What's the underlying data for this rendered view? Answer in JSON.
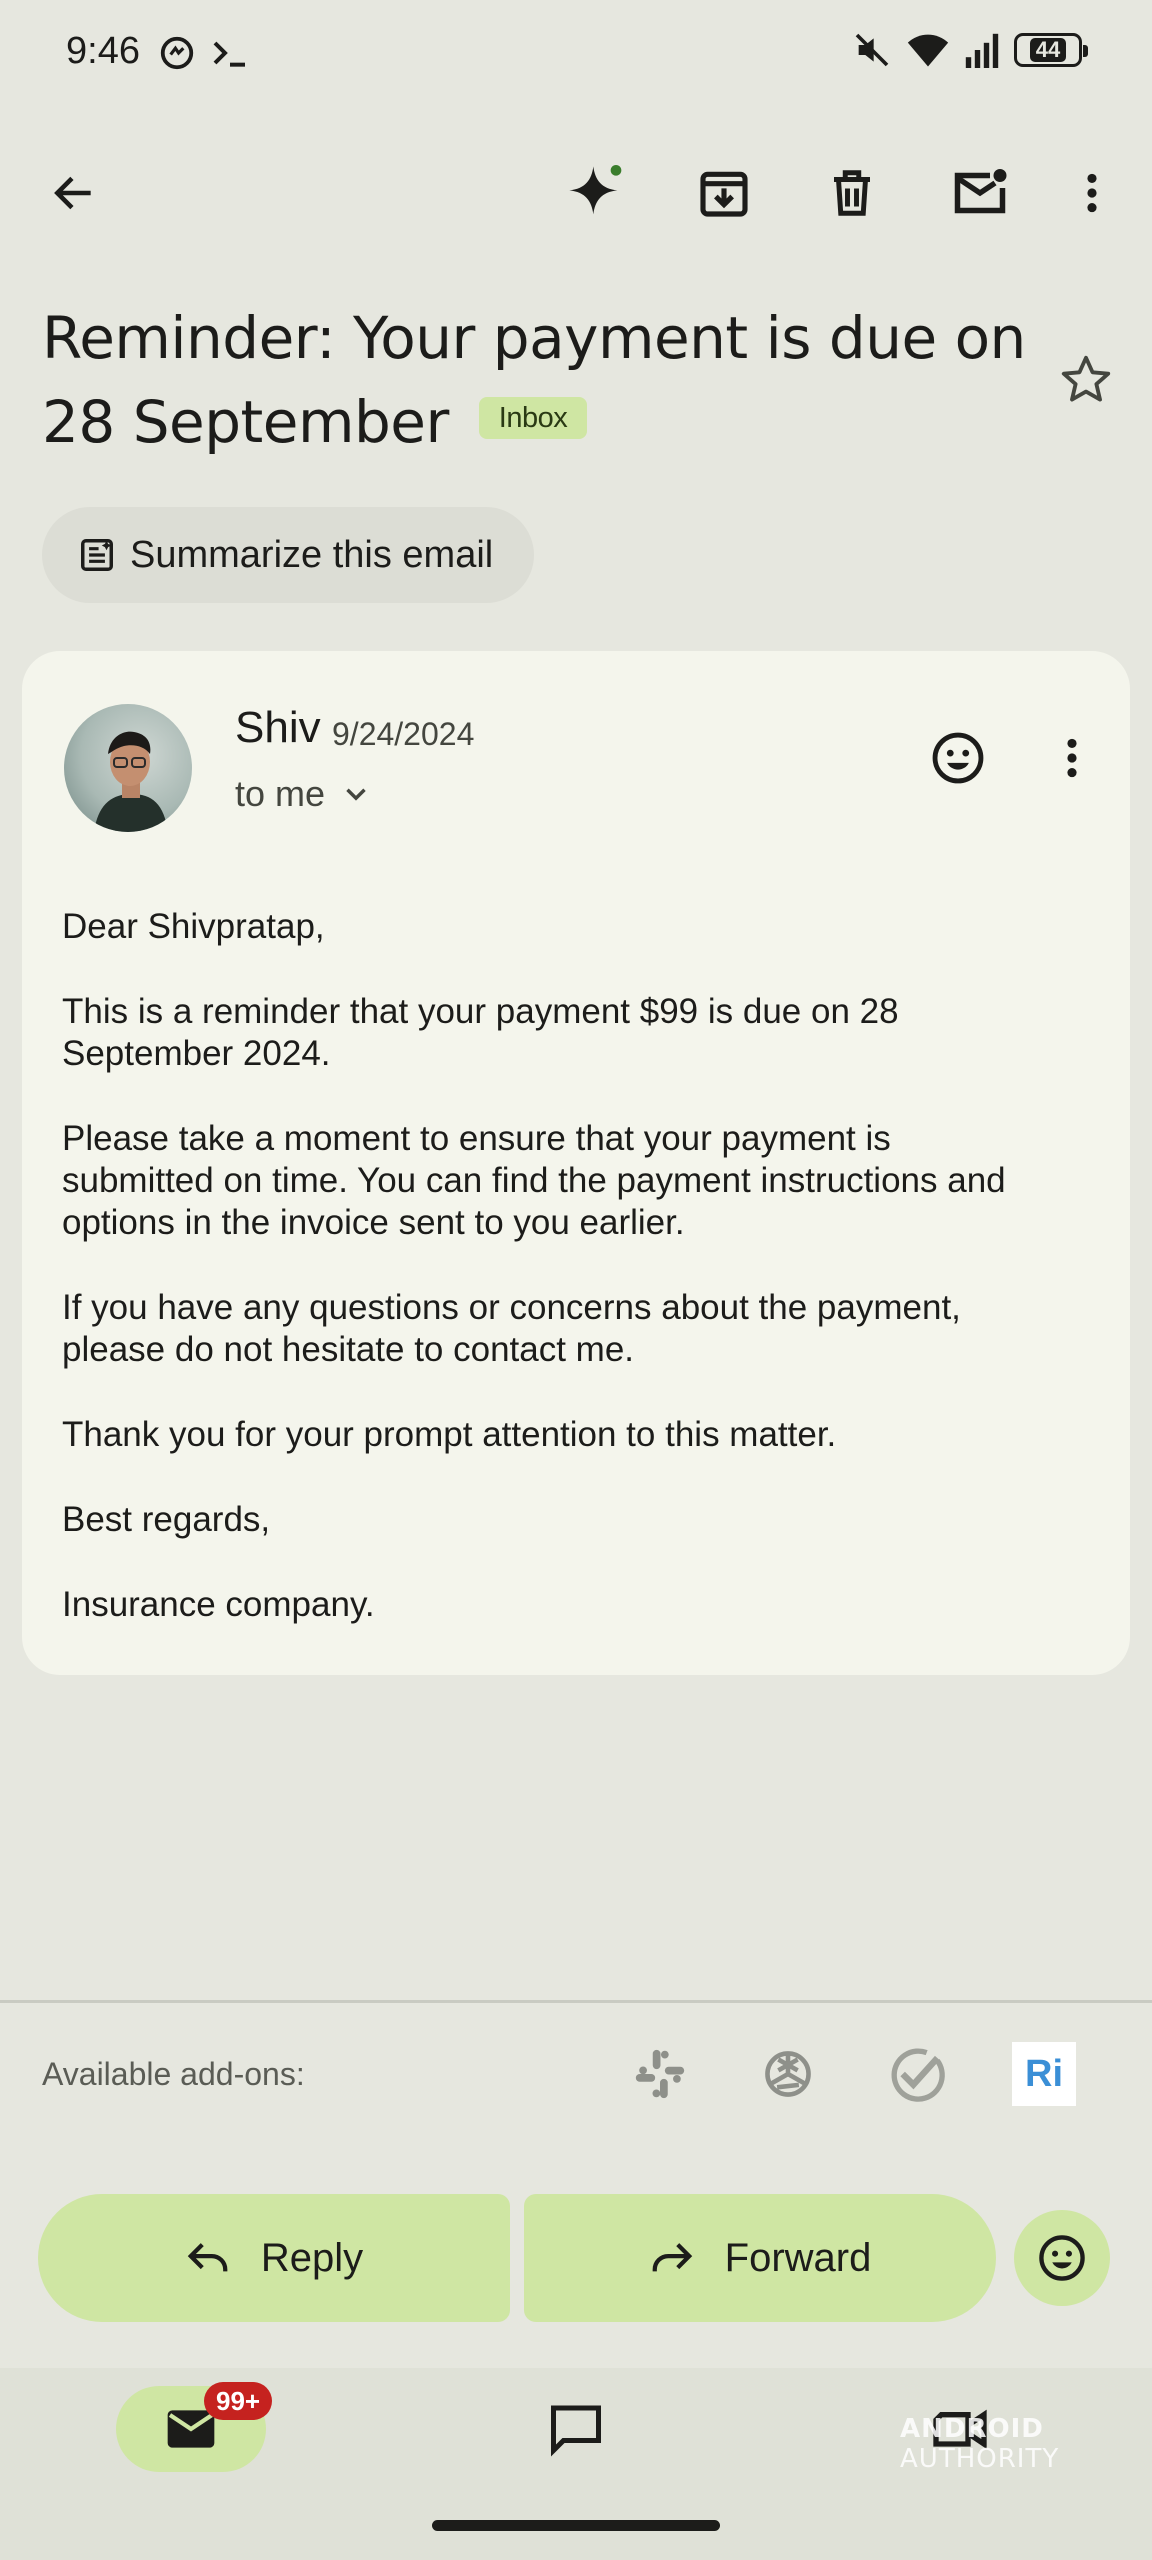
{
  "status_bar": {
    "time": "9:46",
    "battery": "44",
    "icons": [
      "data-saver-icon",
      "terminal-icon",
      "mute-icon",
      "wifi-icon",
      "signal-icon",
      "battery-icon"
    ]
  },
  "toolbar": {
    "icons": [
      "back-arrow-icon",
      "gemini-sparkle-icon",
      "archive-icon",
      "delete-icon",
      "mark-unread-icon",
      "more-vert-icon"
    ]
  },
  "email": {
    "subject": "Reminder: Your payment is due on 28 September",
    "label": "Inbox",
    "summarize_label": "Summarize this email",
    "sender": "Shiv",
    "date": "9/24/2024",
    "recipient": "to me",
    "body": [
      "Dear Shivpratap,",
      "This is a reminder that your payment $99 is due on 28\nSeptember 2024.",
      "Please take a moment to ensure that your payment is\nsubmitted on time. You can find the payment instructions and\noptions in the invoice sent to you earlier.",
      "If you have any questions or concerns about the payment,\nplease do not hesitate to contact me.",
      "Thank you for your prompt attention to this matter.",
      "Best regards,",
      "Insurance company."
    ]
  },
  "addons": {
    "label": "Available add-ons:",
    "items": [
      "slack-icon",
      "openai-icon",
      "check-icon",
      "ri-icon"
    ],
    "ri_text": "Ri"
  },
  "actions": {
    "reply": "Reply",
    "forward": "Forward"
  },
  "bottom_nav": {
    "mail_badge": "99+",
    "items": [
      "mail-icon",
      "chat-icon",
      "meet-icon"
    ]
  },
  "watermark": {
    "brand": "ANDROID",
    "suffix": " AUTHORITY"
  },
  "colors": {
    "background": "#e6e7df",
    "card": "#f4f5ec",
    "accent": "#cfe6a3",
    "badge": "#c5221f"
  }
}
